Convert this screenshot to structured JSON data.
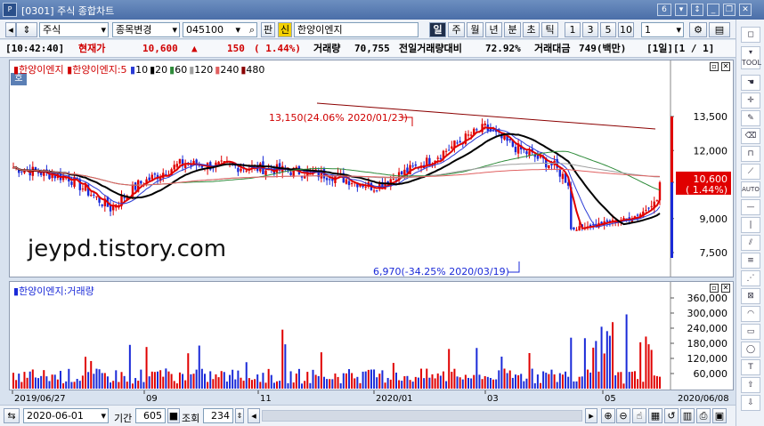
{
  "window": {
    "title": "[0301] 주식 종합차트",
    "app_icon": "P",
    "page_badge": "6"
  },
  "toolbar": {
    "market": "주식",
    "change_label": "종목변경",
    "code": "045100",
    "pan_label": "판",
    "sin_label": "신",
    "stock_name": "한양이엔지",
    "period_buttons": [
      "일",
      "주",
      "월",
      "년",
      "분",
      "초",
      "틱"
    ],
    "active_period": "일",
    "interval_buttons": [
      "1",
      "3",
      "5",
      "10"
    ],
    "interval_value": "1"
  },
  "info": {
    "time": "[10:42:40]",
    "price_label": "현재가",
    "price": "10,600",
    "change_arrow": "▲",
    "change": "150",
    "change_pct": "( 1.44%)",
    "volume_label": "거래량",
    "volume": "70,755",
    "prev_ratio_label": "전일거래량대비",
    "prev_ratio": "72.92%",
    "amount_label": "거래대금",
    "amount": "749(백만)",
    "page_info": "[1일][1 / 1]"
  },
  "price_panel": {
    "badge": "호",
    "legend_name": "한양이엔지",
    "legend_ma_name": "한양이엔지:5",
    "ma_items": [
      {
        "label": "10",
        "color": "#2a3bd6"
      },
      {
        "label": "20",
        "color": "#000000"
      },
      {
        "label": "60",
        "color": "#2e8b3a"
      },
      {
        "label": "120",
        "color": "#a0a0a0"
      },
      {
        "label": "240",
        "color": "#e06060"
      },
      {
        "label": "480",
        "color": "#8b0000"
      }
    ],
    "y_ticks": [
      "13,500",
      "12,000",
      "10,600",
      "9,000",
      "7,500"
    ],
    "current_price_tag": "10,600",
    "current_pct_tag": "( 1.44%)",
    "high_annotation": "13,150(24.06% 2020/01/23)",
    "low_annotation": "6,970(-34.25% 2020/03/19)",
    "watermark": "jeypd.tistory.com"
  },
  "volume_panel": {
    "legend": "한양이엔지:거래량",
    "y_ticks": [
      "360,000",
      "300,000",
      "240,000",
      "180,000",
      "120,000",
      "60,000"
    ]
  },
  "x_axis": {
    "labels": [
      "2019/06/27",
      "09",
      "11",
      "2020/01",
      "03",
      "05"
    ],
    "end_label": "2020/06/08"
  },
  "statusbar": {
    "date": "2020-06-01",
    "period_label": "기간",
    "period_value": "605",
    "query_label": "조회",
    "query_value": "234"
  },
  "colors": {
    "up": "#e00000",
    "down": "#1a2ad8",
    "accent": "#4a6ea8"
  }
}
